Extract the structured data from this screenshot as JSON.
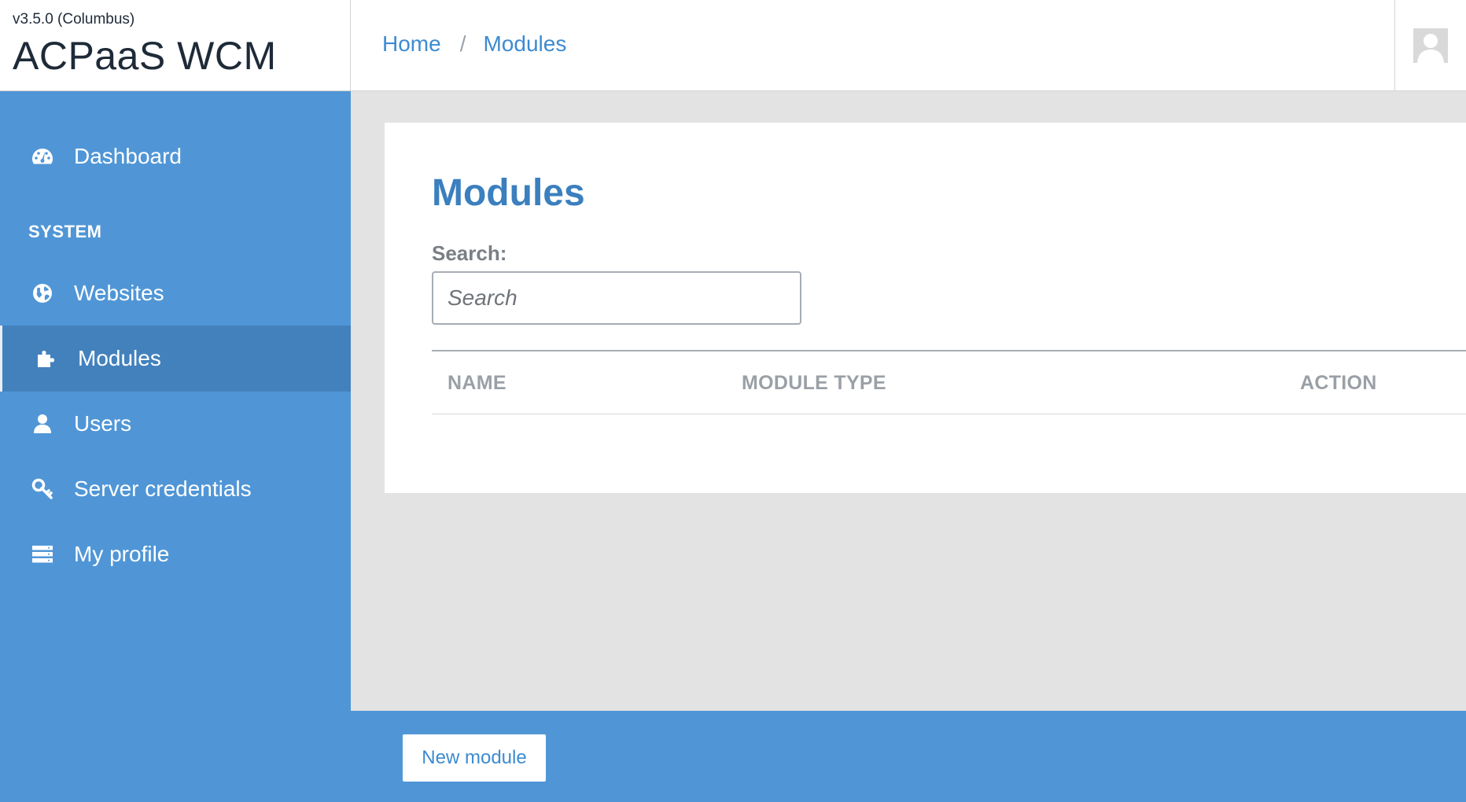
{
  "header": {
    "version": "v3.5.0 (Columbus)",
    "app_title": "ACPaaS WCM",
    "breadcrumb": [
      {
        "label": "Home"
      },
      {
        "label": "Modules"
      }
    ],
    "breadcrumb_separator": "/",
    "avatar_icon": "user-avatar-icon"
  },
  "sidebar": {
    "section_title": "SYSTEM",
    "items": [
      {
        "label": "Dashboard",
        "icon": "dashboard-gauge-icon"
      },
      {
        "label": "Websites",
        "icon": "globe-icon"
      },
      {
        "label": "Modules",
        "icon": "puzzle-icon",
        "active": true
      },
      {
        "label": "Users",
        "icon": "user-icon"
      },
      {
        "label": "Server credentials",
        "icon": "key-icon"
      },
      {
        "label": "My profile",
        "icon": "server-stack-icon"
      }
    ]
  },
  "main": {
    "title": "Modules",
    "search": {
      "label": "Search:",
      "placeholder": "Search",
      "value": ""
    },
    "table": {
      "columns": [
        "NAME",
        "MODULE TYPE",
        "ACTION"
      ],
      "rows": []
    }
  },
  "footer": {
    "new_button_label": "New module"
  },
  "colors": {
    "sidebar": "#5096d6",
    "sidebar_active": "#4381bd",
    "accent": "#3d8bd0",
    "background": "#e3e3e3"
  }
}
